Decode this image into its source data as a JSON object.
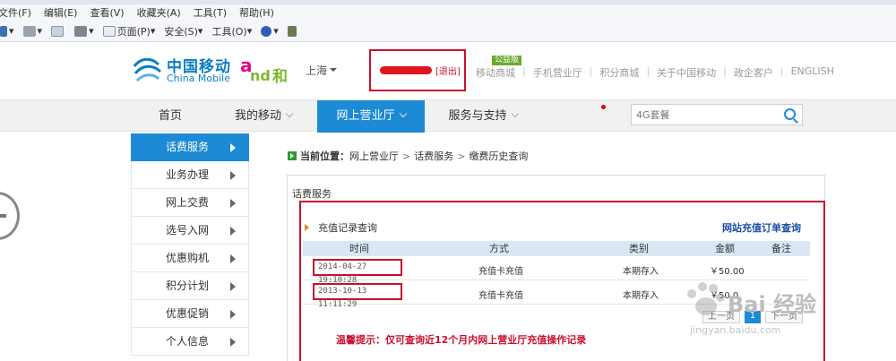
{
  "browser": {
    "menu": [
      "文件(F)",
      "编辑(E)",
      "查看(V)",
      "收藏夹(A)",
      "工具(T)",
      "帮助(H)"
    ],
    "toolbar": [
      "页面(P)",
      "安全(S)",
      "工具(O)"
    ]
  },
  "header": {
    "brand_cn": "中国移动",
    "brand_en": "China Mobile",
    "and_brand": "和",
    "city": "上海",
    "logout": "[退出]",
    "gongyi_badge": "公益版",
    "links": [
      "移动商城",
      "手机营业厅",
      "积分商城",
      "关于中国移动",
      "政企客户",
      "ENGLISH"
    ]
  },
  "nav": {
    "items": [
      "首页",
      "我的移动",
      "网上营业厅",
      "服务与支持"
    ],
    "active_index": 2,
    "search_placeholder": "4G套餐"
  },
  "sidebar": {
    "items": [
      "话费服务",
      "业务办理",
      "网上交费",
      "选号入网",
      "优惠购机",
      "积分计划",
      "优惠促销",
      "个人信息"
    ],
    "active_index": 0
  },
  "breadcrumb": {
    "label": "当前位置：",
    "path": [
      "网上营业厅",
      "话费服务",
      "缴费历史查询"
    ]
  },
  "panel": {
    "title": "话费服务",
    "section_title": "充值记录查询",
    "order_link": "网站充值订单查询",
    "columns": [
      "时间",
      "方式",
      "类别",
      "金额",
      "备注"
    ],
    "rows": [
      {
        "time": "2014-04-27 19:10:28",
        "method": "充值卡充值",
        "type": "本期存入",
        "amount": "￥50.00",
        "note": ""
      },
      {
        "time": "2013-10-13 11:11:29",
        "method": "充值卡充值",
        "type": "本期存入",
        "amount": "￥50.0",
        "note": ""
      }
    ],
    "pager": {
      "prev": "上一页",
      "page": "1",
      "next": "下一页"
    },
    "tip": "温馨提示：仅可查询近12个月内网上营业厅充值操作记录"
  },
  "watermark": {
    "text": "Bai 经验",
    "url": "jingyan.baidu.com"
  },
  "colors": {
    "brand_blue": "#1c8ad4",
    "highlight_red": "#c8102e",
    "china_mobile_blue": "#0a7dc4"
  }
}
